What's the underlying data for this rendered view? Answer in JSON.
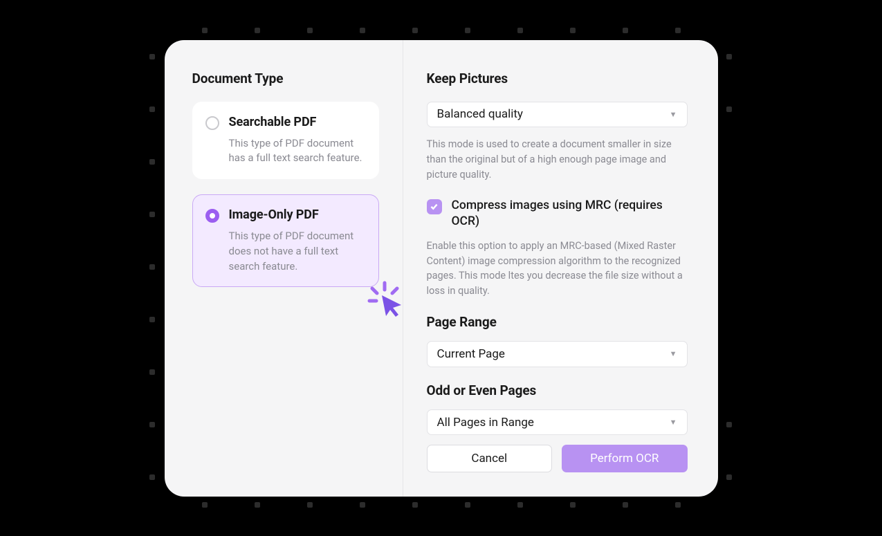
{
  "left": {
    "header": "Document Type",
    "options": [
      {
        "title": "Searchable PDF",
        "desc": "This type of PDF document has a full text search feature."
      },
      {
        "title": "Image-Only PDF",
        "desc": "This type of PDF document does not have a full text search feature."
      }
    ]
  },
  "right": {
    "keep_pictures_label": "Keep Pictures",
    "keep_pictures_value": "Balanced quality",
    "keep_pictures_help": "This mode is used to create a document smaller in size than the original but of a high enough page image and picture quality.",
    "mrc_label": "Compress images using MRC (requires OCR)",
    "mrc_help": "Enable this option to apply an MRC-based (Mixed Raster Content) image compression algorithm to the recognized pages. This mode ltes you decrease the file size without a loss in quality.",
    "page_range_label": "Page Range",
    "page_range_value": "Current Page",
    "odd_even_label": "Odd or Even Pages",
    "odd_even_value": "All Pages in Range",
    "cancel": "Cancel",
    "perform": "Perform OCR"
  }
}
